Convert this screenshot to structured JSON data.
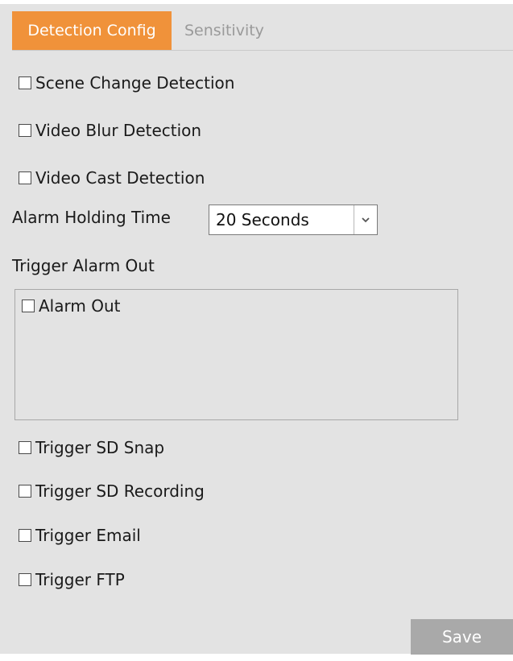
{
  "tabs": {
    "detection_config": "Detection Config",
    "sensitivity": "Sensitivity"
  },
  "options": {
    "scene_change": "Scene Change Detection",
    "video_blur": "Video Blur Detection",
    "video_cast": "Video Cast Detection"
  },
  "alarm_holding": {
    "label": "Alarm Holding Time",
    "selected": "20 Seconds"
  },
  "trigger_alarm_out": {
    "label": "Trigger Alarm Out",
    "items": [
      "Alarm Out"
    ]
  },
  "triggers": {
    "sd_snap": "Trigger SD Snap",
    "sd_recording": "Trigger SD Recording",
    "email": "Trigger Email",
    "ftp": "Trigger FTP"
  },
  "save_label": "Save",
  "colors": {
    "active_tab": "#f0923a",
    "panel_bg": "#e3e3e3",
    "save_button": "#a9a9a9"
  }
}
